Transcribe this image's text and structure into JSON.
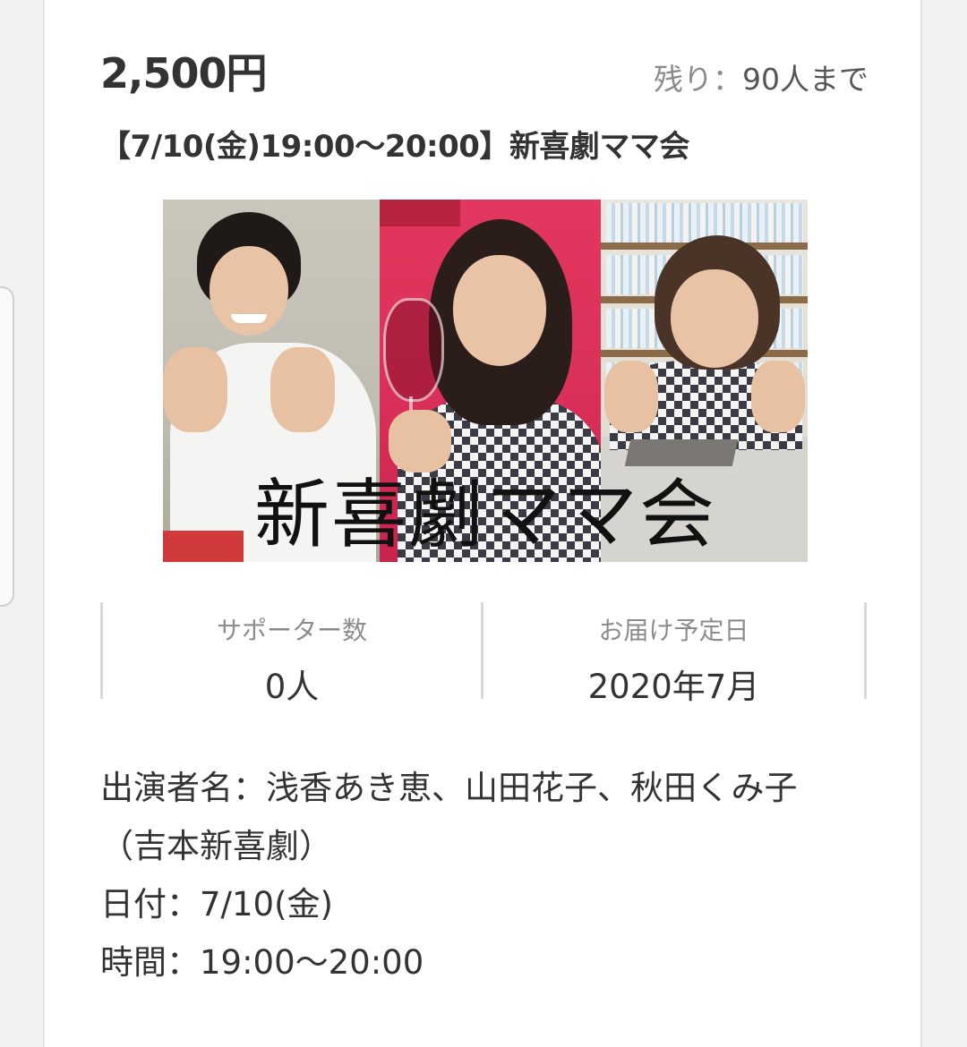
{
  "reward": {
    "price": "2,500円",
    "remaining_label": "残り：",
    "remaining_value": "90人まで",
    "title": "【7/10(金)19:00〜20:00】新喜劇ママ会"
  },
  "banner": {
    "text": "新喜劇ママ会"
  },
  "stats": {
    "supporters_label": "サポーター数",
    "supporters_value": "0人",
    "delivery_label": "お届け予定日",
    "delivery_value": "2020年7月"
  },
  "description": {
    "line1": "出演者名：浅香あき恵、山田花子、秋田くみ子",
    "line2": "（吉本新喜劇）",
    "line3": "日付：7/10(金)",
    "line4": "時間：19:00〜20:00"
  },
  "colors": {
    "text": "#333333",
    "muted": "#8c8c8c",
    "divider": "#d9d9d9",
    "banner_pink": "#d93059"
  }
}
